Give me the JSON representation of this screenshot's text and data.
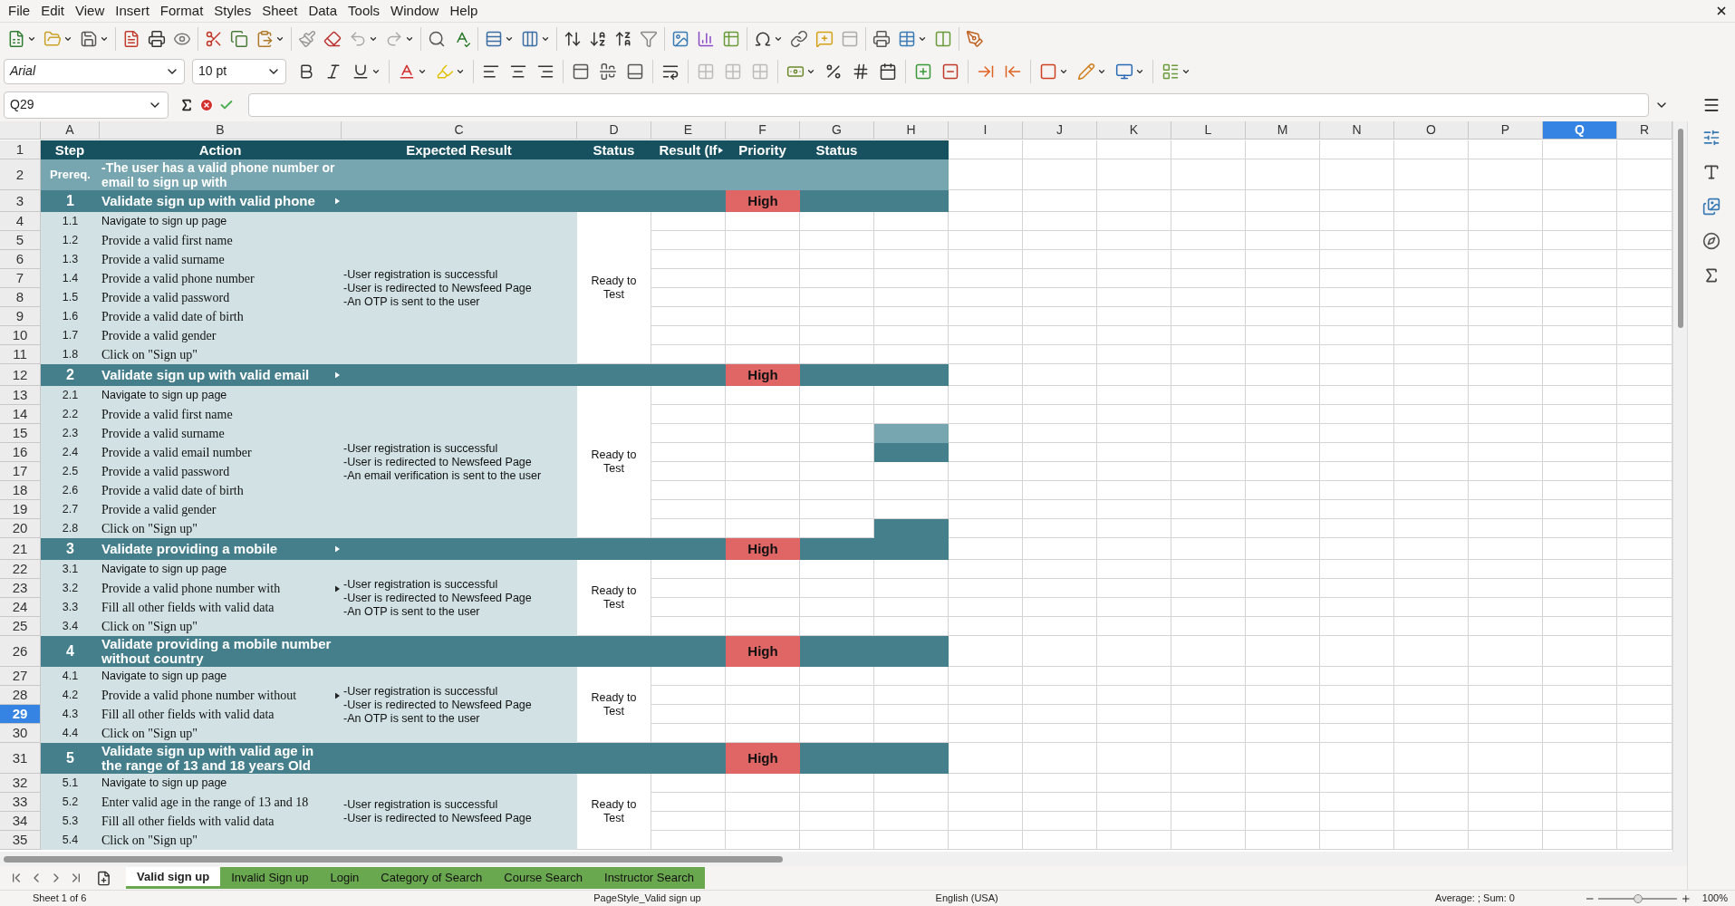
{
  "menu": [
    "File",
    "Edit",
    "View",
    "Insert",
    "Format",
    "Styles",
    "Sheet",
    "Data",
    "Tools",
    "Window",
    "Help"
  ],
  "formatting": {
    "font_name": "Arial",
    "font_size": "10 pt"
  },
  "name_box": "Q29",
  "columns": [
    {
      "label": "A",
      "selected": false
    },
    {
      "label": "B",
      "selected": false
    },
    {
      "label": "C",
      "selected": false
    },
    {
      "label": "D",
      "selected": false
    },
    {
      "label": "E",
      "selected": false
    },
    {
      "label": "F",
      "selected": false
    },
    {
      "label": "G",
      "selected": false
    },
    {
      "label": "H",
      "selected": false
    },
    {
      "label": "I",
      "selected": false
    },
    {
      "label": "J",
      "selected": false
    },
    {
      "label": "K",
      "selected": false
    },
    {
      "label": "L",
      "selected": false
    },
    {
      "label": "M",
      "selected": false
    },
    {
      "label": "N",
      "selected": false
    },
    {
      "label": "O",
      "selected": false
    },
    {
      "label": "P",
      "selected": false
    },
    {
      "label": "Q",
      "selected": true
    },
    {
      "label": "R",
      "selected": false
    }
  ],
  "header_row": {
    "row": "1",
    "selected": false,
    "cells": [
      {
        "text": "Step",
        "clipped": false
      },
      {
        "text": "Action",
        "clipped": false
      },
      {
        "text": "Expected Result",
        "clipped": false
      },
      {
        "text": "Status",
        "clipped": false
      },
      {
        "text": "Result (If",
        "clipped": true
      },
      {
        "text": "Priority",
        "clipped": false
      },
      {
        "text": "Status",
        "clipped": false
      }
    ]
  },
  "prerequisite": {
    "row": "2",
    "selected": false,
    "label": "Prereq.",
    "text": "-The user has a valid phone number or email to sign up with"
  },
  "test_cases": [
    {
      "row": "3",
      "selected": false,
      "step": "1",
      "title": "Validate sign up with valid phone",
      "clipped": true,
      "priority": "High",
      "expected": [
        "-User registration is successful",
        "-User is redirected to Newsfeed Page",
        "-An OTP is sent to the user"
      ],
      "status": "Ready to Test",
      "steps": [
        {
          "row": "4",
          "selected": false,
          "number": "1.1",
          "action": "Navigate to sign up page",
          "kind": "sans",
          "clipped": false
        },
        {
          "row": "5",
          "selected": false,
          "number": "1.2",
          "action": "Provide a valid first name",
          "kind": "serif",
          "clipped": false
        },
        {
          "row": "6",
          "selected": false,
          "number": "1.3",
          "action": "Provide a valid surname",
          "kind": "serif",
          "clipped": false
        },
        {
          "row": "7",
          "selected": false,
          "number": "1.4",
          "action": "Provide a valid phone number",
          "kind": "serif",
          "clipped": false
        },
        {
          "row": "8",
          "selected": false,
          "number": "1.5",
          "action": "Provide a valid password",
          "kind": "serif",
          "clipped": false
        },
        {
          "row": "9",
          "selected": false,
          "number": "1.6",
          "action": "Provide a valid date of birth",
          "kind": "serif",
          "clipped": false
        },
        {
          "row": "10",
          "selected": false,
          "number": "1.7",
          "action": "Provide a valid gender",
          "kind": "serif",
          "clipped": false
        },
        {
          "row": "11",
          "selected": false,
          "number": "1.8",
          "action": "Click on \"Sign up\"",
          "kind": "serif",
          "clipped": false
        }
      ]
    },
    {
      "row": "12",
      "selected": false,
      "step": "2",
      "title": "Validate sign up with valid email",
      "clipped": true,
      "priority": "High",
      "expected": [
        "-User registration is successful",
        "-User is redirected to Newsfeed Page",
        "-An email verification is sent to the user"
      ],
      "status": "Ready to Test",
      "steps": [
        {
          "row": "13",
          "selected": false,
          "number": "2.1",
          "action": "Navigate to sign up page",
          "kind": "sans",
          "clipped": false
        },
        {
          "row": "14",
          "selected": false,
          "number": "2.2",
          "action": "Provide a valid first name",
          "kind": "serif",
          "clipped": false
        },
        {
          "row": "15",
          "selected": false,
          "number": "2.3",
          "action": "Provide a valid surname",
          "kind": "serif",
          "clipped": false,
          "color": "#78a6b0"
        },
        {
          "row": "16",
          "selected": false,
          "number": "2.4",
          "action": "Provide a valid email number",
          "kind": "serif",
          "clipped": false,
          "color": "#457f8c"
        },
        {
          "row": "17",
          "selected": false,
          "number": "2.5",
          "action": "Provide a valid password",
          "kind": "serif",
          "clipped": false
        },
        {
          "row": "18",
          "selected": false,
          "number": "2.6",
          "action": "Provide a valid date of birth",
          "kind": "serif",
          "clipped": false
        },
        {
          "row": "19",
          "selected": false,
          "number": "2.7",
          "action": "Provide a valid gender",
          "kind": "serif",
          "clipped": false
        },
        {
          "row": "20",
          "selected": false,
          "number": "2.8",
          "action": "Click on \"Sign up\"",
          "kind": "serif",
          "clipped": false,
          "color": "#457f8c"
        }
      ]
    },
    {
      "row": "21",
      "selected": false,
      "step": "3",
      "title": "Validate providing a mobile",
      "clipped": true,
      "priority": "High",
      "expected": [
        "-User registration is successful",
        "-User is redirected to Newsfeed Page",
        "-An OTP is sent to the user"
      ],
      "status": "Ready to Test",
      "steps": [
        {
          "row": "22",
          "selected": false,
          "number": "3.1",
          "action": "Navigate to sign up page",
          "kind": "sans",
          "clipped": false
        },
        {
          "row": "23",
          "selected": false,
          "number": "3.2",
          "action": "Provide a valid phone number with",
          "kind": "serif",
          "clipped": true
        },
        {
          "row": "24",
          "selected": false,
          "number": "3.3",
          "action": "Fill all other fields with valid data",
          "kind": "serif",
          "clipped": false
        },
        {
          "row": "25",
          "selected": false,
          "number": "3.4",
          "action": "Click on \"Sign up\"",
          "kind": "serif",
          "clipped": false
        }
      ]
    },
    {
      "row": "26",
      "selected": false,
      "step": "4",
      "title": "Validate providing a mobile number without country",
      "clipped": false,
      "priority": "High",
      "expected": [
        "-User registration is successful",
        "-User is redirected to Newsfeed Page",
        "-An OTP is sent to the user"
      ],
      "status": "Ready to Test",
      "steps": [
        {
          "row": "27",
          "selected": false,
          "number": "4.1",
          "action": "Navigate to sign up page",
          "kind": "sans",
          "clipped": false
        },
        {
          "row": "28",
          "selected": false,
          "number": "4.2",
          "action": "Provide a valid phone number without",
          "kind": "serif",
          "clipped": true
        },
        {
          "row": "29",
          "selected": true,
          "number": "4.3",
          "action": "Fill all other fields with valid data",
          "kind": "serif",
          "clipped": false
        },
        {
          "row": "30",
          "selected": false,
          "number": "4.4",
          "action": "Click on \"Sign up\"",
          "kind": "serif",
          "clipped": false
        }
      ]
    },
    {
      "row": "31",
      "selected": false,
      "step": "5",
      "title": "Validate sign up with valid age in the range of 13 and 18 years Old",
      "clipped": false,
      "priority": "High",
      "expected": [
        "-User registration is successful",
        "-User is redirected to Newsfeed Page"
      ],
      "status": "Ready to Test",
      "steps": [
        {
          "row": "32",
          "selected": false,
          "number": "5.1",
          "action": "Navigate to sign up page",
          "kind": "sans",
          "clipped": false
        },
        {
          "row": "33",
          "selected": false,
          "number": "5.2",
          "action": "Enter valid age in the range of 13 and 18",
          "kind": "serif",
          "clipped": false
        },
        {
          "row": "34",
          "selected": false,
          "number": "5.3",
          "action": "Fill all other fields with valid data",
          "kind": "serif",
          "clipped": false
        },
        {
          "row": "35",
          "selected": false,
          "number": "5.4",
          "action": "Click on \"Sign up\"",
          "kind": "serif",
          "clipped": false
        }
      ]
    }
  ],
  "sheet_tabs": [
    {
      "label": "Valid sign up",
      "selected": true
    },
    {
      "label": "Invalid Sign up",
      "selected": false
    },
    {
      "label": "Login",
      "selected": false
    },
    {
      "label": "Category of Search",
      "selected": false
    },
    {
      "label": "Course Search",
      "selected": false
    },
    {
      "label": "Instructor Search",
      "selected": false
    }
  ],
  "status_bar": {
    "sheet": "Sheet 1 of 6",
    "page_style": "PageStyle_Valid sign up",
    "language": "English (USA)",
    "summary": "Average: ; Sum: 0",
    "zoom": "100%",
    "zoom_slider": {
      "level": 0.5
    }
  }
}
